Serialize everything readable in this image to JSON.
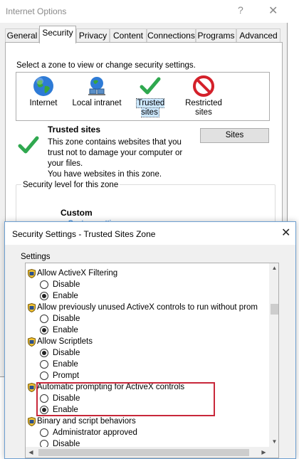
{
  "internet_options": {
    "title": "Internet Options",
    "help_glyph": "?",
    "close_glyph": "✕",
    "tabs": [
      {
        "label": "General"
      },
      {
        "label": "Security",
        "active": true
      },
      {
        "label": "Privacy"
      },
      {
        "label": "Content"
      },
      {
        "label": "Connections"
      },
      {
        "label": "Programs"
      },
      {
        "label": "Advanced"
      }
    ],
    "zone_prompt": "Select a zone to view or change security settings.",
    "zones": [
      {
        "label": "Internet",
        "icon": "globe-icon"
      },
      {
        "label": "Local intranet",
        "icon": "intranet-icon"
      },
      {
        "label": "Trusted sites",
        "icon": "checkmark-icon",
        "selected": true
      },
      {
        "label": "Restricted sites",
        "icon": "restricted-icon"
      }
    ],
    "selected_zone": {
      "heading": "Trusted sites",
      "description_lines": [
        "This zone contains websites that you",
        "trust not to damage your computer or",
        "your files.",
        "You have websites in this zone."
      ],
      "sites_button": "Sites"
    },
    "security_level_legend": "Security level for this zone",
    "level_name": "Custom",
    "custom_link": "Custom settings"
  },
  "security_settings": {
    "title": "Security Settings - Trusted Sites Zone",
    "close_glyph": "✕",
    "settings_label": "Settings",
    "items": [
      {
        "label": "Allow ActiveX Filtering",
        "options": [
          {
            "label": "Disable",
            "checked": false
          },
          {
            "label": "Enable",
            "checked": true
          }
        ]
      },
      {
        "label": "Allow previously unused ActiveX controls to run without prom",
        "options": [
          {
            "label": "Disable",
            "checked": false
          },
          {
            "label": "Enable",
            "checked": true
          }
        ]
      },
      {
        "label": "Allow Scriptlets",
        "options": [
          {
            "label": "Disable",
            "checked": true
          },
          {
            "label": "Enable",
            "checked": false
          },
          {
            "label": "Prompt",
            "checked": false
          }
        ]
      },
      {
        "label": "Automatic prompting for ActiveX controls",
        "highlighted": true,
        "options": [
          {
            "label": "Disable",
            "checked": false
          },
          {
            "label": "Enable",
            "checked": true
          }
        ]
      },
      {
        "label": "Binary and script behaviors",
        "options": [
          {
            "label": "Administrator approved",
            "checked": false
          },
          {
            "label": "Disable",
            "checked": false
          }
        ]
      }
    ],
    "highlight_color": "#c8283a"
  },
  "colors": {
    "selection": "#cce8ff",
    "link": "#0066cc"
  }
}
